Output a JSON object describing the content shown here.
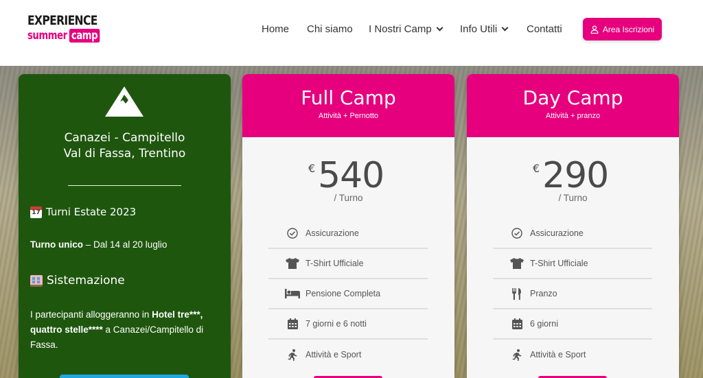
{
  "logo": {
    "top": "EXPERIENCE",
    "bottom_left": "summer",
    "bottom_right": "camp"
  },
  "nav": {
    "home": "Home",
    "chi_siamo": "Chi siamo",
    "nostri_camp": "I Nostri Camp",
    "info_utili": "Info Utili",
    "contatti": "Contatti",
    "area_iscrizioni": "Area Iscrizioni"
  },
  "info": {
    "location_line1": "Canazei - Campitello",
    "location_line2": "Val di Fassa, Trentino",
    "turni_heading": "Turni Estate 2023",
    "turno_bold": "Turno unico",
    "turno_rest": " – Dal 14 al 20 luglio",
    "sistemazione_heading": "Sistemazione",
    "sist_text1": "I partecipanti alloggeranno in ",
    "sist_bold1": "Hotel tre***,",
    "sist_bold2": "quattro stelle****",
    "sist_text2": " a Canazei/Campitello di",
    "sist_text3": "Fassa."
  },
  "full_camp": {
    "title": "Full Camp",
    "subtitle": "Attività + Pernotto",
    "currency": "€",
    "price": "540",
    "per": "/ Turno",
    "features": [
      {
        "icon": "check-circle-icon",
        "label": "Assicurazione"
      },
      {
        "icon": "tshirt-icon",
        "label": "T-Shirt Ufficiale"
      },
      {
        "icon": "bed-icon",
        "label": "Pensione Completa"
      },
      {
        "icon": "calendar-icon",
        "label": "7 giorni e 6 notti"
      },
      {
        "icon": "running-icon",
        "label": "Attività e Sport"
      }
    ]
  },
  "day_camp": {
    "title": "Day Camp",
    "subtitle": "Attività + pranzo",
    "currency": "€",
    "price": "290",
    "per": "/ Turno",
    "features": [
      {
        "icon": "check-circle-icon",
        "label": "Assicurazione"
      },
      {
        "icon": "tshirt-icon",
        "label": "T-Shirt Ufficiale"
      },
      {
        "icon": "utensils-icon",
        "label": "Pranzo"
      },
      {
        "icon": "calendar-icon",
        "label": "6 giorni"
      },
      {
        "icon": "running-icon",
        "label": "Attività e Sport"
      }
    ]
  },
  "colors": {
    "brand_pink": "#e6007e",
    "card_green": "#1f560e",
    "cta_cyan": "#1ea8e0"
  }
}
